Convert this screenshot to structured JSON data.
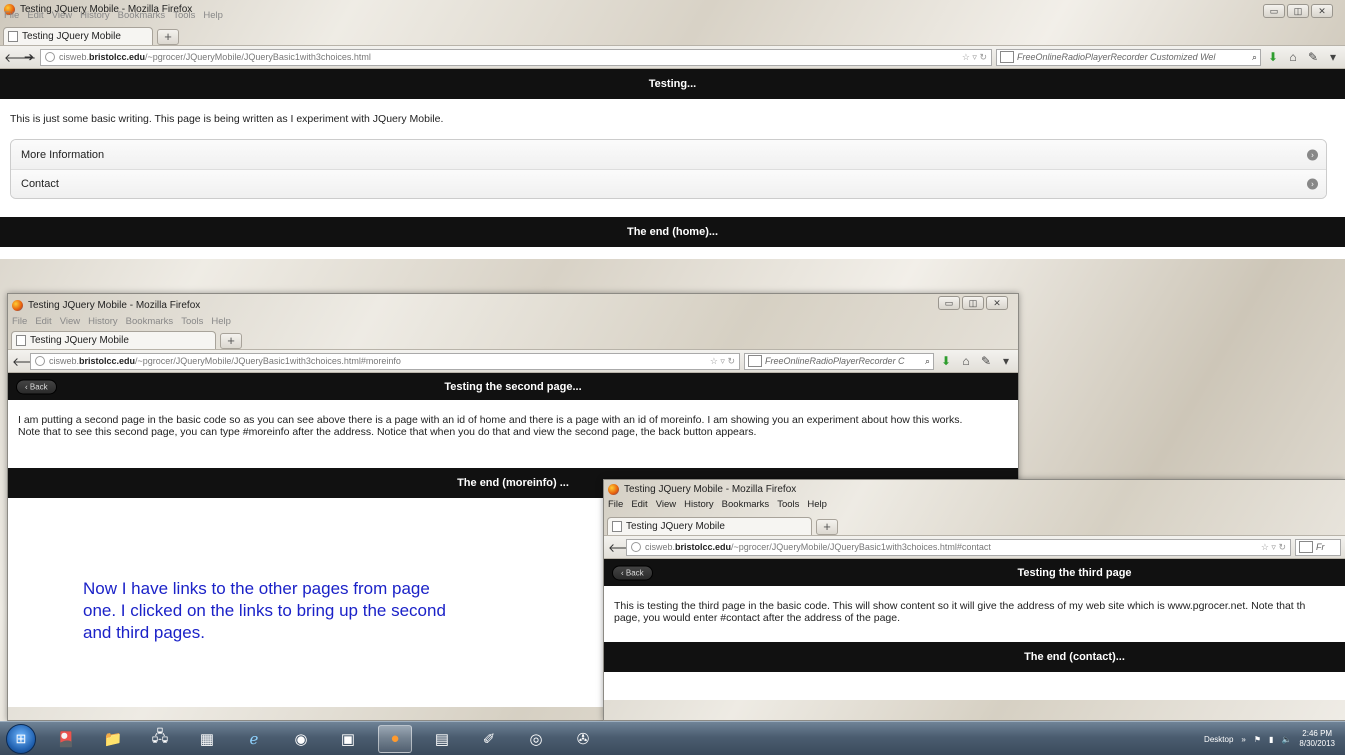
{
  "browser_title": "Testing JQuery Mobile - Mozilla Firefox",
  "menu": [
    "File",
    "Edit",
    "View",
    "History",
    "Bookmarks",
    "Tools",
    "Help"
  ],
  "tab_label": "Testing JQuery Mobile",
  "new_tab": "+",
  "search_engine_text": "FreeOnlineRadioPlayerRecorder Customized Wel",
  "search_engine_text_short": "FreeOnlineRadioPlayerRecorder C",
  "search_engine_text_tiny": "Fr",
  "win1": {
    "url_prefix": "cisweb.",
    "url_host": "bristolcc.edu",
    "url_path": "/~pgrocer/JQueryMobile/JQueryBasic1with3choices.html",
    "header": "Testing...",
    "body_text": "This is just some basic writing. This page is being written as I experiment with JQuery Mobile.",
    "list": [
      {
        "label": "More Information"
      },
      {
        "label": "Contact"
      }
    ],
    "footer": "The end (home)..."
  },
  "win2": {
    "url_prefix": "cisweb.",
    "url_host": "bristolcc.edu",
    "url_path": "/~pgrocer/JQueryMobile/JQueryBasic1with3choices.html#moreinfo",
    "back_label": "Back",
    "header": "Testing the second page...",
    "body_line1": "I am putting a second page in the basic code so as you can see above there is a page with an id of home and there is a page with an id of moreinfo. I am showing you an experiment about how this works.",
    "body_line2": "Note that to see this second page, you can type #moreinfo after the address. Notice that when you do that and view the second page, the back button appears.",
    "footer": "The end (moreinfo) ..."
  },
  "win3": {
    "url_prefix": "cisweb.",
    "url_host": "bristolcc.edu",
    "url_path": "/~pgrocer/JQueryMobile/JQueryBasic1with3choices.html#contact",
    "back_label": "Back",
    "header": "Testing the third page",
    "body_line1": "This is testing the third page in the basic code. This will show content so it will give the address of my web site which is www.pgrocer.net. Note that th",
    "body_line2": "page, you would enter #contact after the address of the page.",
    "footer": "The end (contact)..."
  },
  "annotation": "Now I have links to the other pages from page one. I clicked on the links to bring up the second and third pages.",
  "taskbar": {
    "desktop_label": "Desktop",
    "time": "2:46 PM",
    "date": "8/30/2013"
  }
}
